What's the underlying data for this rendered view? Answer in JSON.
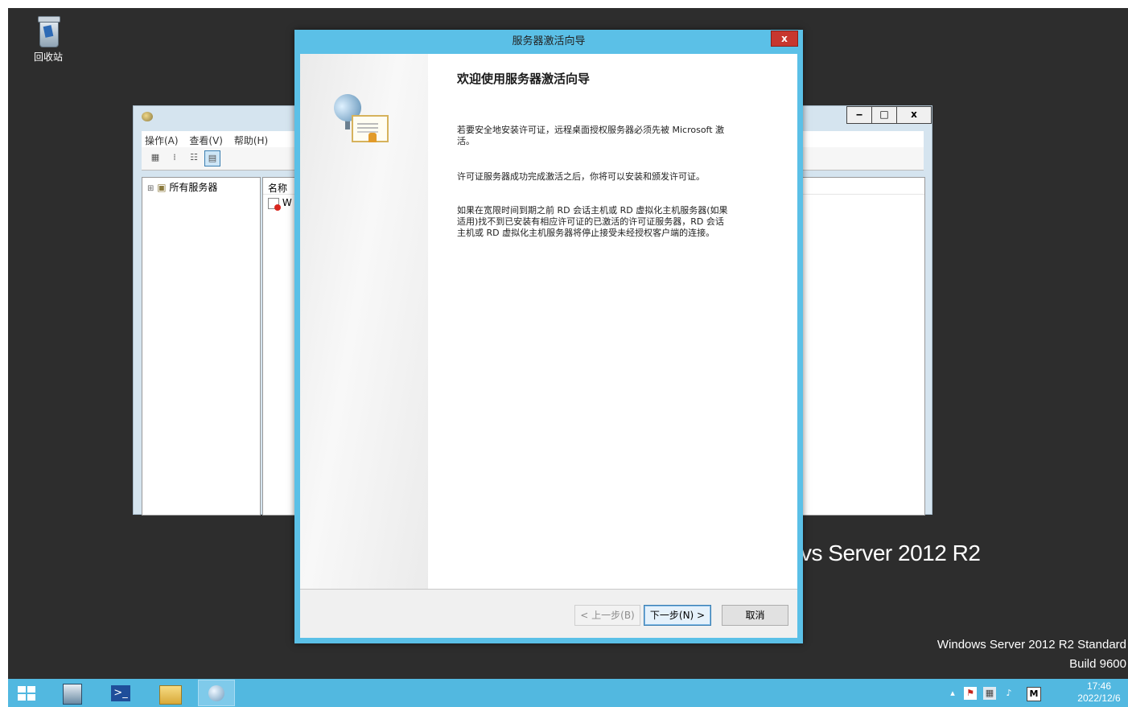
{
  "desktop": {
    "icons": [
      {
        "label": "回收站",
        "icon": "recycle-bin-icon"
      }
    ],
    "brand_text": "vs Server 2012 R2",
    "edition_line1": "Windows Server 2012 R2 Standard",
    "edition_line2": "Build 9600"
  },
  "mmc": {
    "menu": [
      "操作(A)",
      "查看(V)",
      "帮助(H)"
    ],
    "window_buttons": {
      "minimize": "‒",
      "maximize": "□",
      "close": "x"
    },
    "tree": {
      "root_label": "所有服务器"
    },
    "list": {
      "column_name": "名称",
      "row1": "W"
    }
  },
  "wizard": {
    "title": "服务器激活向导",
    "close_glyph": "x",
    "heading": "欢迎使用服务器激活向导",
    "paragraphs": [
      "若要安全地安装许可证，远程桌面授权服务器必须先被 Microsoft 激活。",
      "许可证服务器成功完成激活之后，你将可以安装和颁发许可证。",
      "如果在宽限时间到期之前 RD 会话主机或 RD 虚拟化主机服务器(如果适用)找不到已安装有相应许可证的已激活的许可证服务器，RD 会话主机或 RD 虚拟化主机服务器将停止接受未经授权客户端的连接。"
    ],
    "buttons": {
      "back": "< 上一步(B)",
      "next": "下一步(N) >",
      "cancel": "取消"
    }
  },
  "taskbar": {
    "apps": [
      "start-icon",
      "server-manager-icon",
      "powershell-icon",
      "file-explorer-icon",
      "rd-licensing-manager-icon"
    ],
    "tray": {
      "ime": "M",
      "time": "17:46",
      "date": "2022/12/6"
    }
  },
  "colors": {
    "accent": "#5bc0e7",
    "taskbar": "#52b8e0",
    "desktop": "#2d2d2d"
  }
}
